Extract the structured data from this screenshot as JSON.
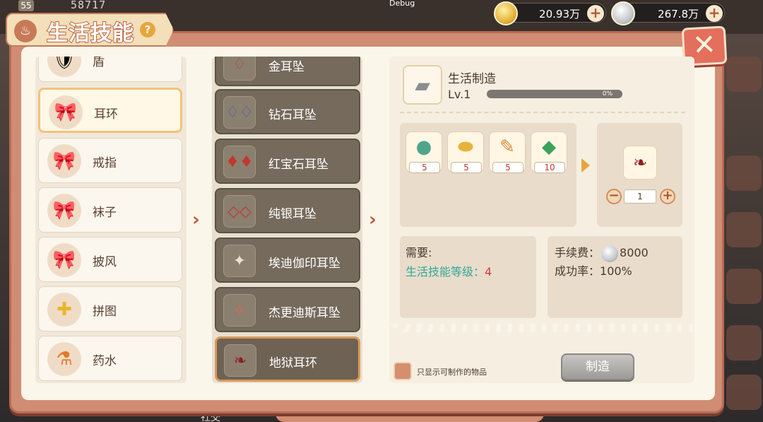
{
  "hud": {
    "level": "55",
    "power": "58717",
    "debug": "Debug",
    "gold": "20.93万",
    "silver": "267.8万"
  },
  "panel": {
    "title": "生活技能",
    "help": "?",
    "close": "✕"
  },
  "categories": [
    {
      "label": "盾",
      "icon": "shield-icon"
    },
    {
      "label": "耳环",
      "icon": "bow-icon"
    },
    {
      "label": "戒指",
      "icon": "bow-icon"
    },
    {
      "label": "袜子",
      "icon": "bow-icon"
    },
    {
      "label": "披风",
      "icon": "bow-icon"
    },
    {
      "label": "拼图",
      "icon": "puzzle-icon"
    },
    {
      "label": "药水",
      "icon": "potion-icon"
    }
  ],
  "items": [
    {
      "label": "金耳坠",
      "icon": "earring-icon"
    },
    {
      "label": "钻石耳坠",
      "icon": "earring-icon"
    },
    {
      "label": "红宝石耳坠",
      "icon": "earring-icon"
    },
    {
      "label": "纯银耳坠",
      "icon": "earring-icon"
    },
    {
      "label": "埃迪伽印耳坠",
      "icon": "earring-icon"
    },
    {
      "label": "杰更迪斯耳坠",
      "icon": "earring-icon"
    },
    {
      "label": "地狱耳环",
      "icon": "earring-icon"
    }
  ],
  "craft": {
    "name": "生活制造",
    "level": "Lv.1",
    "progress_text": "0%",
    "progress": 0,
    "materials": [
      {
        "icon": "orb-icon",
        "count": "5"
      },
      {
        "icon": "gold-ore-icon",
        "count": "5"
      },
      {
        "icon": "feather-icon",
        "count": "5"
      },
      {
        "icon": "crystal-icon",
        "count": "10"
      }
    ],
    "quantity": "1",
    "minus": "−",
    "plus": "+"
  },
  "requirements": {
    "title": "需要:",
    "line_label": "生活技能等级：",
    "line_value": "4"
  },
  "fee": {
    "label": "手续费：",
    "amount": "8000",
    "rate_label": "成功率：",
    "rate_value": "100%"
  },
  "footer": {
    "checkbox_label": "只显示可制作的物品",
    "make_button": "制造",
    "bottom_text": "社交"
  }
}
